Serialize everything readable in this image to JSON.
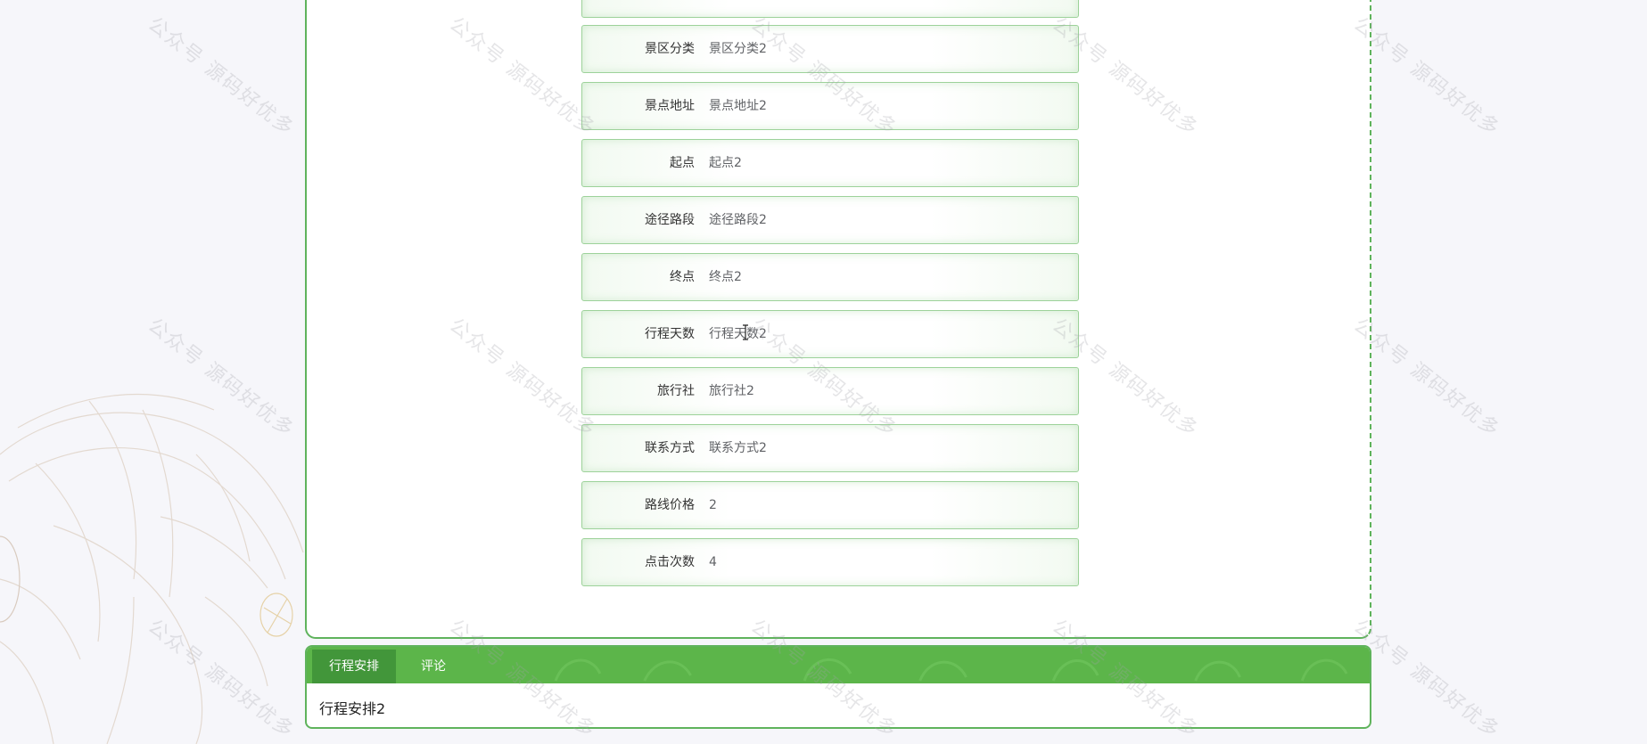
{
  "detail": {
    "fields": [
      {
        "label": "景区分类",
        "value": "景区分类2"
      },
      {
        "label": "景点地址",
        "value": "景点地址2"
      },
      {
        "label": "起点",
        "value": "起点2"
      },
      {
        "label": "途径路段",
        "value": "途径路段2"
      },
      {
        "label": "终点",
        "value": "终点2"
      },
      {
        "label": "行程天数",
        "value": "行程天数2"
      },
      {
        "label": "旅行社",
        "value": "旅行社2"
      },
      {
        "label": "联系方式",
        "value": "联系方式2"
      },
      {
        "label": "路线价格",
        "value": "2"
      },
      {
        "label": "点击次数",
        "value": "4"
      }
    ]
  },
  "tabs": {
    "items": [
      {
        "label": "行程安排",
        "active": true
      },
      {
        "label": "评论",
        "active": false
      }
    ],
    "content": "行程安排2"
  },
  "watermark": {
    "text": "公众号 源码好优多"
  },
  "colors": {
    "accent": "#5fb35c",
    "tab_bar": "#5cb54a",
    "tab_active": "#42963a",
    "row_border": "#9dd29a"
  },
  "icons": {
    "cursor": "text-cursor-icon",
    "decoration": "lotus-lineart-decoration"
  }
}
